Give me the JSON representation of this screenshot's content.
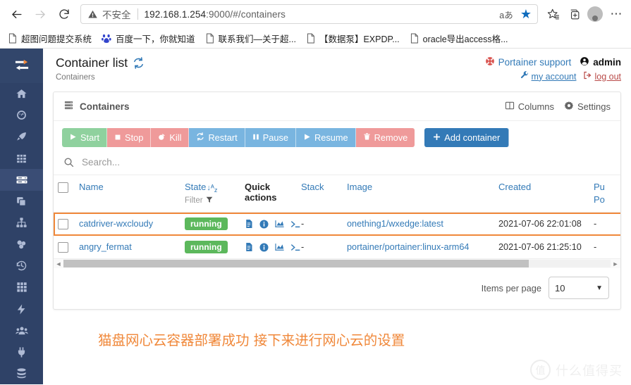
{
  "browser": {
    "back": "back-arrow",
    "forward": "forward-arrow",
    "reload": "reload",
    "security_label": "不安全",
    "url_host": "192.168.1.254",
    "url_rest": ":9000/#/containers",
    "reading_mode": "aあ",
    "favorite": "★",
    "collections": "collections",
    "profile": "profile",
    "more": "⋯",
    "bookmarks": [
      {
        "label": "超图问题提交系统",
        "icon": "page-icon"
      },
      {
        "label": "百度一下，你就知道",
        "icon": "baidu-icon"
      },
      {
        "label": "联系我们—关于超...",
        "icon": "page-icon"
      },
      {
        "label": "【数据泵】EXPDP...",
        "icon": "page-icon"
      },
      {
        "label": "oracle导出access格...",
        "icon": "page-icon"
      }
    ]
  },
  "sidebar": {
    "toggle": "collapse-toggle",
    "items": [
      {
        "name": "home",
        "icon": "home-icon",
        "active": false
      },
      {
        "name": "dashboard",
        "icon": "dashboard-icon",
        "active": false
      },
      {
        "name": "app-templates",
        "icon": "rocket-icon",
        "active": false
      },
      {
        "name": "stacks",
        "icon": "list-icon",
        "active": false
      },
      {
        "name": "containers",
        "icon": "containers-icon",
        "active": true
      },
      {
        "name": "images",
        "icon": "images-icon",
        "active": false
      },
      {
        "name": "networks",
        "icon": "network-icon",
        "active": false
      },
      {
        "name": "volumes",
        "icon": "volumes-icon",
        "active": false
      },
      {
        "name": "events",
        "icon": "history-icon",
        "active": false
      },
      {
        "name": "host",
        "icon": "grid-icon",
        "active": false
      },
      {
        "name": "endpoints",
        "icon": "bolt-icon",
        "active": false
      },
      {
        "name": "users",
        "icon": "users-icon",
        "active": false
      },
      {
        "name": "registries",
        "icon": "plug-icon",
        "active": false
      },
      {
        "name": "settings",
        "icon": "database-icon",
        "active": false
      }
    ]
  },
  "header": {
    "title": "Container list",
    "refresh_icon": "refresh-icon",
    "breadcrumb": "Containers",
    "support_label": "Portainer support",
    "support_icon": "lifebuoy-icon",
    "user_label": "admin",
    "user_icon": "user-icon",
    "my_account_label": "my account",
    "my_account_icon": "wrench-icon",
    "logout_label": "log out",
    "logout_icon": "logout-icon"
  },
  "panel": {
    "title": "Containers",
    "title_icon": "containers-icon",
    "columns_label": "Columns",
    "columns_icon": "columns-icon",
    "settings_label": "Settings",
    "settings_icon": "gear-icon"
  },
  "toolbar": {
    "buttons": [
      {
        "label": "Start",
        "icon": "play-icon",
        "style": "green"
      },
      {
        "label": "Stop",
        "icon": "stop-icon",
        "style": "red"
      },
      {
        "label": "Kill",
        "icon": "kill-icon",
        "style": "red"
      },
      {
        "label": "Restart",
        "icon": "restart-icon",
        "style": "blue"
      },
      {
        "label": "Pause",
        "icon": "pause-icon",
        "style": "blue"
      },
      {
        "label": "Resume",
        "icon": "play-icon",
        "style": "blue"
      },
      {
        "label": "Remove",
        "icon": "trash-icon",
        "style": "red"
      }
    ],
    "add_label": "Add container",
    "add_icon": "plus-icon"
  },
  "search": {
    "placeholder": "Search...",
    "value": "",
    "icon": "search-icon"
  },
  "table": {
    "columns": [
      {
        "label": "Name",
        "sort": "",
        "style": "link"
      },
      {
        "label": "State",
        "sort": "sort-az-icon",
        "filter": "Filter",
        "filter_icon": "funnel-icon",
        "style": "link"
      },
      {
        "label": "Quick actions",
        "style": "black"
      },
      {
        "label": "Stack",
        "style": "link"
      },
      {
        "label": "Image",
        "style": "link"
      },
      {
        "label": "Created",
        "style": "link"
      },
      {
        "label": "Pu",
        "label2": "Po",
        "style": "link"
      }
    ],
    "rows": [
      {
        "selected": false,
        "highlighted": true,
        "name": "catdriver-wxcloudy",
        "state": "running",
        "quick_actions": [
          "logs-icon",
          "inspect-icon",
          "stats-icon",
          "console-icon"
        ],
        "stack": "-",
        "image": "onething1/wxedge:latest",
        "created": "2021-07-06 22:01:08",
        "ports": "-"
      },
      {
        "selected": false,
        "highlighted": false,
        "name": "angry_fermat",
        "state": "running",
        "quick_actions": [
          "logs-icon",
          "inspect-icon",
          "stats-icon",
          "console-icon"
        ],
        "stack": "-",
        "image": "portainer/portainer:linux-arm64",
        "created": "2021-07-06 21:25:10",
        "ports": "-"
      }
    ]
  },
  "footer": {
    "items_per_page_label": "Items per page",
    "items_per_page_value": "10"
  },
  "annotation": {
    "text": "猫盘网心云容器部署成功 接下来进行网心云的设置",
    "color": "#f0883a"
  },
  "watermark": {
    "mark": "值",
    "text": "什么值得买"
  }
}
